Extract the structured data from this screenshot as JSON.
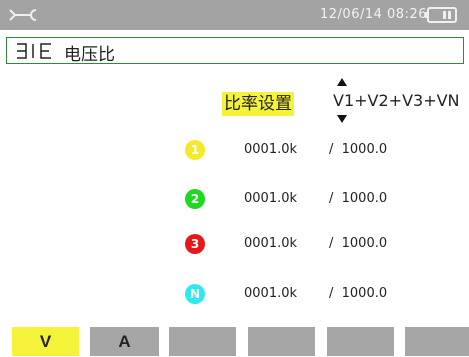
{
  "status_bar": {
    "icon": "wrench-icon",
    "datetime": "12/06/14 08:26",
    "battery_icon": "battery-icon"
  },
  "header": {
    "icon": "three-phase-icon",
    "title": "电压比"
  },
  "ratio_setting": {
    "label": "比率设置",
    "selection": "V1+V2+V3+VN",
    "highlight_color": "#f5f23a"
  },
  "channels": [
    {
      "badge": "1",
      "color": "#f5ea2a",
      "primary": "0001.0k",
      "secondary": "/  1000.0"
    },
    {
      "badge": "2",
      "color": "#20d820",
      "primary": "0001.0k",
      "secondary": "/  1000.0"
    },
    {
      "badge": "3",
      "color": "#e81818",
      "primary": "0001.0k",
      "secondary": "/  1000.0"
    },
    {
      "badge": "N",
      "color": "#30e8f0",
      "primary": "0001.0k",
      "secondary": "/  1000.0"
    }
  ],
  "tabs": [
    {
      "label": "V",
      "active": true
    },
    {
      "label": "A",
      "active": false
    },
    {
      "label": "",
      "active": false
    },
    {
      "label": "",
      "active": false
    },
    {
      "label": "",
      "active": false
    },
    {
      "label": "",
      "active": false
    }
  ],
  "colors": {
    "status_bar": "#a3a3a3",
    "title_border": "#2e8b3e",
    "tab_inactive": "#a6a6a6",
    "tab_active": "#f5f23a"
  }
}
